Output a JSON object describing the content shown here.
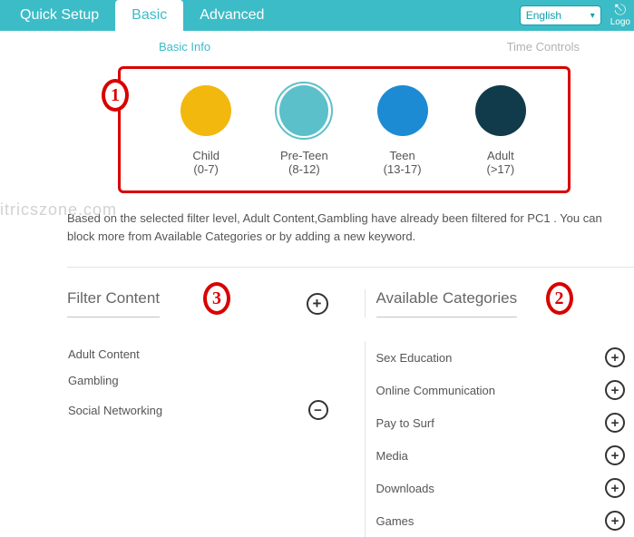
{
  "tabs": {
    "quick_setup": "Quick Setup",
    "basic": "Basic",
    "advanced": "Advanced"
  },
  "language": "English",
  "logout_label": "Logo",
  "subtabs": {
    "basic_info": "Basic Info",
    "time_controls": "Time Controls"
  },
  "watermark": "itricszone.com",
  "profiles": [
    {
      "name": "Child",
      "range": "(0-7)",
      "color": "#f2b80e",
      "selected": false
    },
    {
      "name": "Pre-Teen",
      "range": "(8-12)",
      "color": "#5bc0c9",
      "selected": true
    },
    {
      "name": "Teen",
      "range": "(13-17)",
      "color": "#1c8bd4",
      "selected": false
    },
    {
      "name": "Adult",
      "range": "(>17)",
      "color": "#113b4b",
      "selected": false
    }
  ],
  "badges": {
    "one": "1",
    "two": "2",
    "three": "3"
  },
  "description": "Based on the selected filter level, Adult Content,Gambling have already been filtered for PC1 . You can block more from Available Categories or by adding a new keyword.",
  "filter": {
    "title": "Filter Content",
    "items": [
      {
        "label": "Adult Content",
        "removable": false
      },
      {
        "label": "Gambling",
        "removable": false
      },
      {
        "label": "Social Networking",
        "removable": true
      }
    ]
  },
  "available": {
    "title": "Available Categories",
    "items": [
      {
        "label": "Sex Education"
      },
      {
        "label": "Online Communication"
      },
      {
        "label": "Pay to Surf"
      },
      {
        "label": "Media"
      },
      {
        "label": "Downloads"
      },
      {
        "label": "Games"
      }
    ]
  },
  "glyphs": {
    "plus": "+",
    "minus": "−",
    "caret": "▾",
    "logout": "⎋"
  }
}
